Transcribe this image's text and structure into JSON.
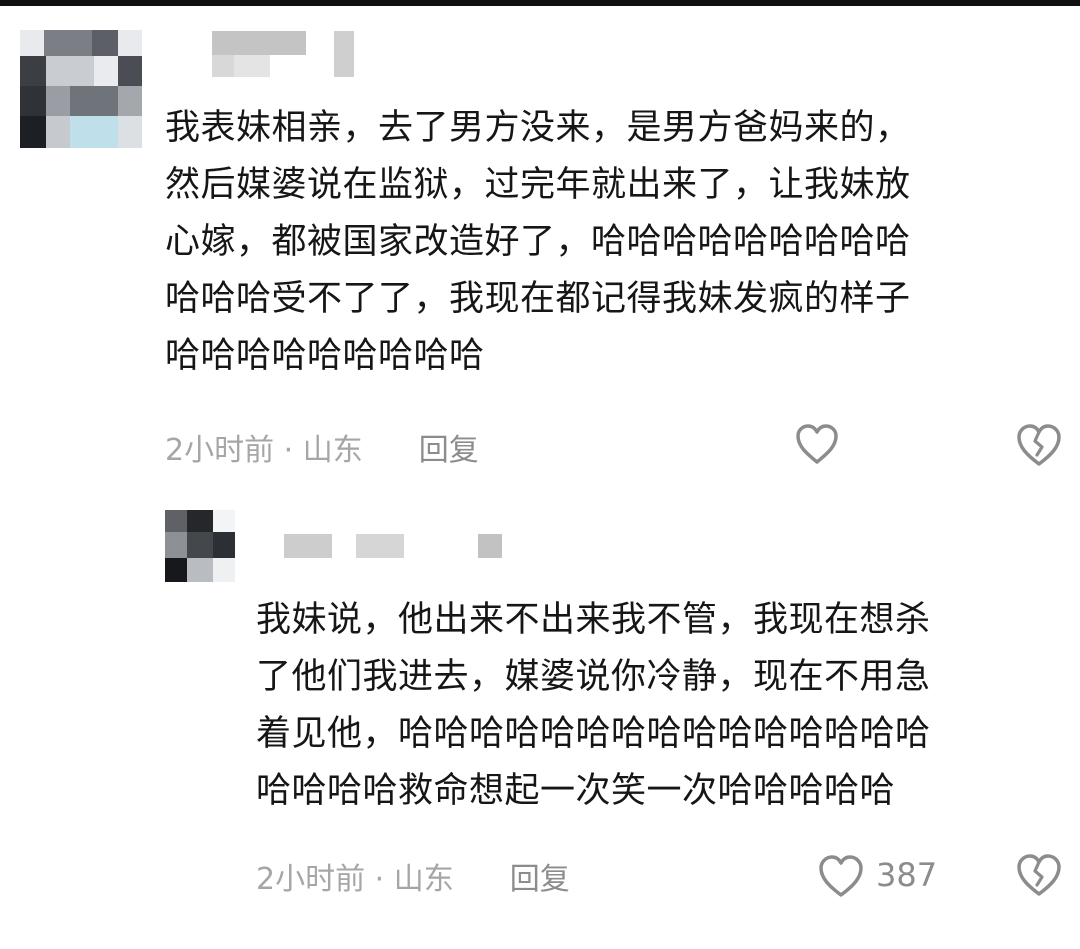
{
  "comments": [
    {
      "text": "我表妹相亲，去了男方没来，是男方爸妈来的，\n然后媒婆说在监狱，过完年就出来了，让我妹放\n心嫁，都被国家改造好了，哈哈哈哈哈哈哈哈哈\n哈哈哈受不了了，我现在都记得我妹发疯的样子\n哈哈哈哈哈哈哈哈哈",
      "time": "2小时前 · 山东",
      "reply_label": "回复",
      "like_count": ""
    },
    {
      "text": "我妹说，他出来不出来我不管，我现在想杀\n了他们我进去，媒婆说你冷静，现在不用急\n着见他，哈哈哈哈哈哈哈哈哈哈哈哈哈哈哈\n哈哈哈哈救命想起一次笑一次哈哈哈哈哈",
      "time": "2小时前 · 山东",
      "reply_label": "回复",
      "like_count": "387"
    }
  ],
  "icons": {
    "like": "heart-outline-icon",
    "dislike": "broken-heart-icon"
  },
  "colors": {
    "text": "#161616",
    "meta": "#a6a6a6",
    "icon": "#8c8c8c"
  }
}
